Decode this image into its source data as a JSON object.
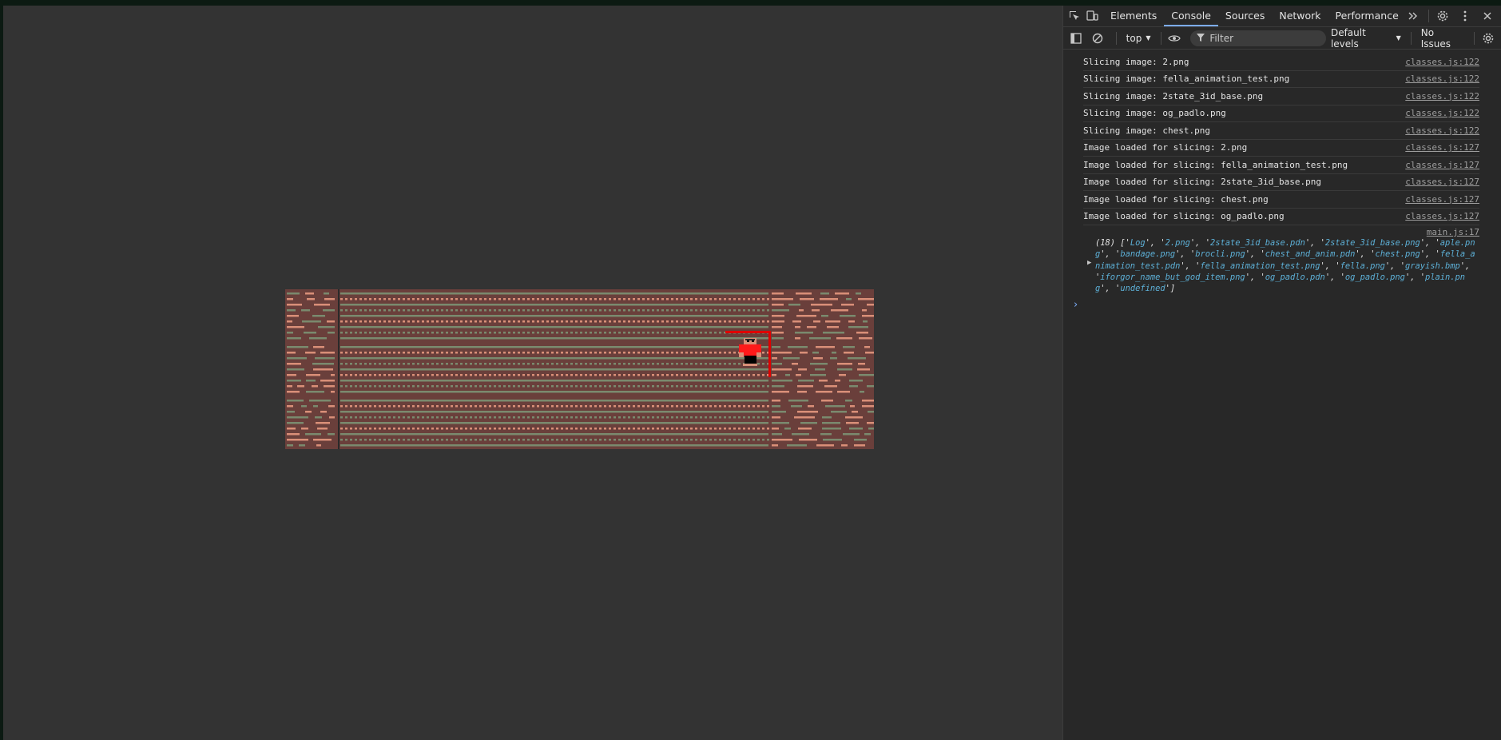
{
  "devtools": {
    "tabs": [
      "Elements",
      "Console",
      "Sources",
      "Network",
      "Performance"
    ],
    "active_tab": "Console",
    "more_tabs_icon": "chevron-double-right-icon",
    "toolbar": {
      "context": "top",
      "filter_placeholder": "Filter",
      "levels": "Default levels",
      "issues": "No Issues"
    },
    "console": {
      "rows": [
        {
          "text": "Slicing image: 2.png",
          "source": "classes.js:122"
        },
        {
          "text": "Slicing image: fella_animation_test.png",
          "source": "classes.js:122"
        },
        {
          "text": "Slicing image: 2state_3id_base.png",
          "source": "classes.js:122"
        },
        {
          "text": "Slicing image: og_padlo.png",
          "source": "classes.js:122"
        },
        {
          "text": "Slicing image: chest.png",
          "source": "classes.js:122"
        },
        {
          "text": "Image loaded for slicing: 2.png",
          "source": "classes.js:127"
        },
        {
          "text": "Image loaded for slicing: fella_animation_test.png",
          "source": "classes.js:127"
        },
        {
          "text": "Image loaded for slicing: 2state_3id_base.png",
          "source": "classes.js:127"
        },
        {
          "text": "Image loaded for slicing: chest.png",
          "source": "classes.js:127"
        },
        {
          "text": "Image loaded for slicing: og_padlo.png",
          "source": "classes.js:127"
        }
      ],
      "array_log": {
        "source": "main.js:17",
        "count": "(18)",
        "items": [
          "Log",
          "2.png",
          "2state_3id_base.pdn",
          "2state_3id_base.png",
          "aple.png",
          "bandage.png",
          "brocli.png",
          "chest_and_anim.pdn",
          "chest.png",
          "fella_animation_test.pdn",
          "fella_animation_test.png",
          "fella.png",
          "grayish.bmp",
          "iforgor_name_but_god_item.png",
          "og_padlo.pdn",
          "og_padlo.png",
          "plain.png",
          "undefined"
        ]
      },
      "prompt": "›"
    }
  },
  "colors": {
    "page_bg": "#333333",
    "tile_bg": "#6a3f3b",
    "tile_green": "#7a8a6e",
    "tile_peach": "#d98f78",
    "player_red": "#ff1a1a",
    "selection_red": "#e00000",
    "accent": "#7cacf8"
  }
}
